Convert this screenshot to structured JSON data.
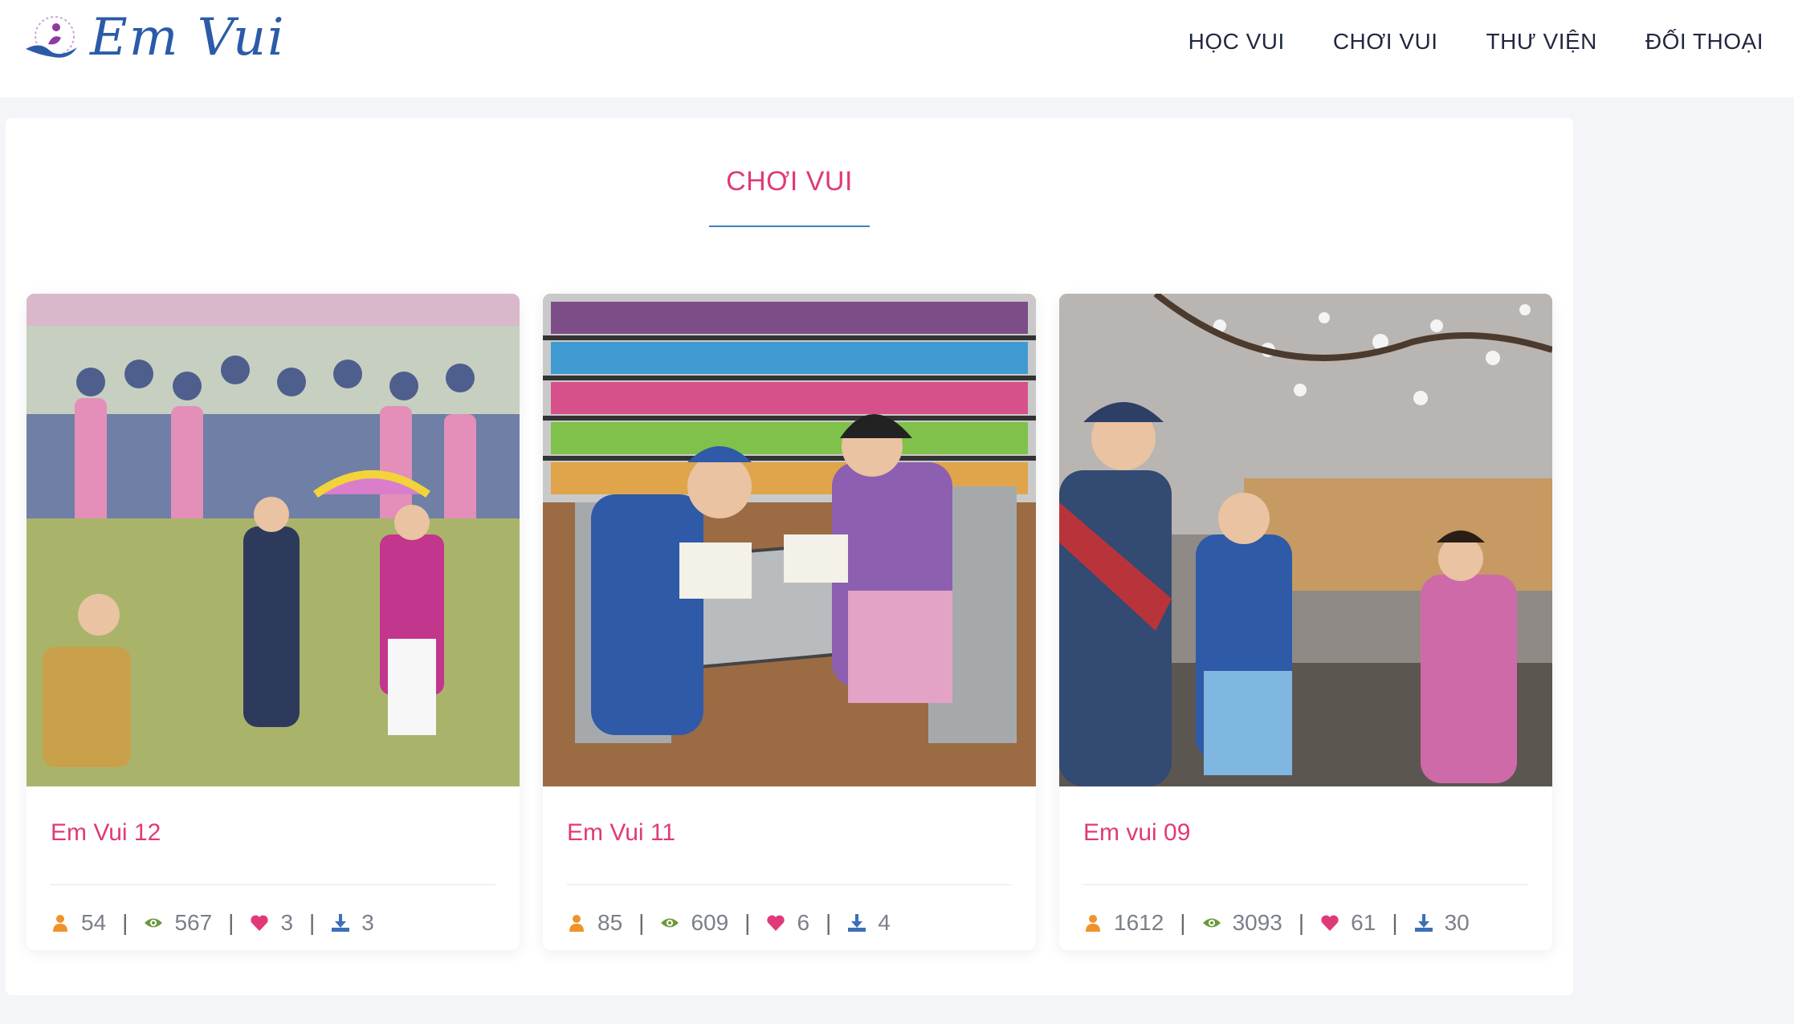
{
  "header": {
    "brand": "Em Vui",
    "nav": [
      "HỌC VUI",
      "CHƠI VUI",
      "THƯ VIỆN",
      "ĐỐI THOẠI"
    ]
  },
  "section": {
    "title": "CHƠI VUI"
  },
  "cards": [
    {
      "title": "Em Vui 12",
      "users": "54",
      "views": "567",
      "likes": "3",
      "downloads": "3",
      "image": "illustration: festival crowd, umbrella, traditional dance"
    },
    {
      "title": "Em Vui 11",
      "users": "85",
      "views": "609",
      "likes": "6",
      "downloads": "4",
      "image": "illustration: children reading at library table"
    },
    {
      "title": "Em vui 09",
      "users": "1612",
      "views": "3093",
      "likes": "61",
      "downloads": "30",
      "image": "illustration: family greeting under blossom tree"
    }
  ],
  "icons": {
    "user": "user-icon",
    "view": "eye-icon",
    "like": "heart-icon",
    "download": "download-icon"
  },
  "colors": {
    "accent_pink": "#e0397a",
    "brand_blue": "#2b5ba8",
    "user_orange": "#f0922b",
    "eye_green": "#6a9a3a",
    "download_blue": "#3d6fb8"
  }
}
